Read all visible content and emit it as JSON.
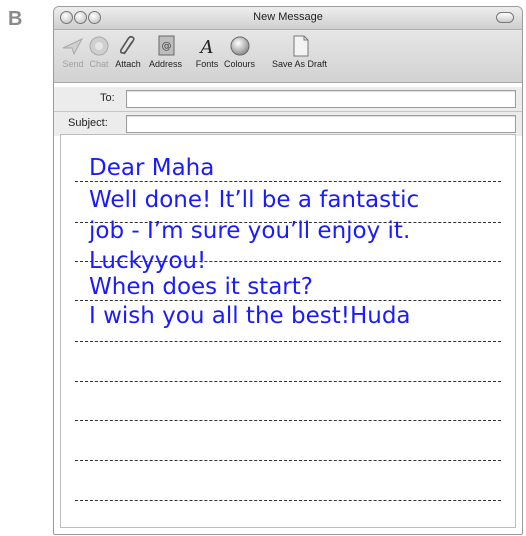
{
  "section_letter": "B",
  "window": {
    "title": "New Message"
  },
  "toolbar": {
    "items": [
      {
        "label": "Send",
        "icon": "send-icon",
        "enabled": false
      },
      {
        "label": "Chat",
        "icon": "chat-icon",
        "enabled": false
      },
      {
        "label": "Attach",
        "icon": "paperclip-icon",
        "enabled": true
      },
      {
        "label": "Address",
        "icon": "address-book-icon",
        "enabled": true
      },
      {
        "label": "Fonts",
        "icon": "fonts-icon",
        "enabled": true
      },
      {
        "label": "Colours",
        "icon": "colours-icon",
        "enabled": true
      },
      {
        "label": "Save As Draft",
        "icon": "save-draft-icon",
        "enabled": true
      }
    ]
  },
  "fields": {
    "to_label": "To:",
    "to_value": "",
    "subject_label": "Subject:",
    "subject_value": ""
  },
  "message_lines": [
    "Dear Maha",
    "Well done! It’ll be a fantastic",
    "job - I’m sure you’ll enjoy it.",
    "Luckyyou!",
    "When does it start?",
    "I wish you all the best!Huda"
  ],
  "colors": {
    "handwriting": "#1a1aff",
    "window_chrome": "#d8d8d8"
  }
}
